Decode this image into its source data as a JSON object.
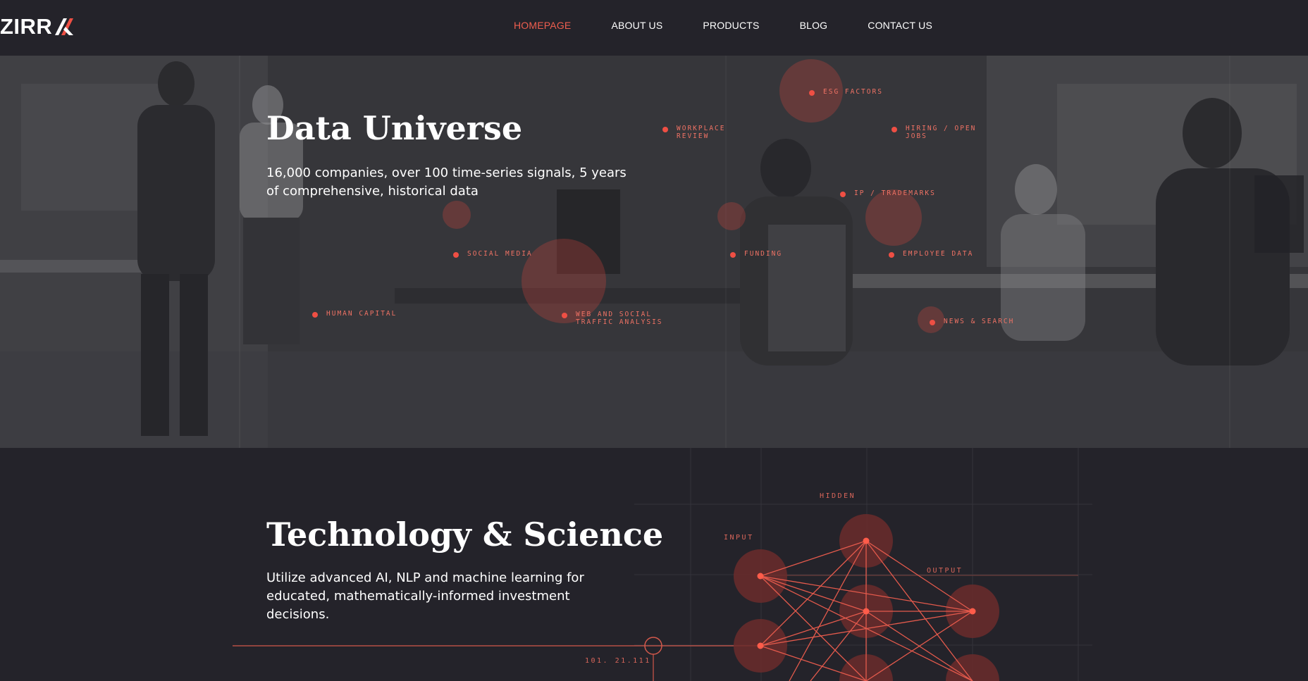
{
  "brand": {
    "name": "ZIRR"
  },
  "nav": {
    "items": [
      {
        "label": "HOMEPAGE",
        "active": true
      },
      {
        "label": "ABOUT US",
        "active": false
      },
      {
        "label": "PRODUCTS",
        "active": false
      },
      {
        "label": "BLOG",
        "active": false
      },
      {
        "label": "CONTACT US",
        "active": false
      }
    ]
  },
  "hero": {
    "title": "Data Universe",
    "subtitle": "16,000 companies, over 100 time-series signals, 5 years of comprehensive, historical data",
    "tags": [
      {
        "line1": "ESG FACTORS",
        "line2": ""
      },
      {
        "line1": "WORKPLACE",
        "line2": "REVIEW"
      },
      {
        "line1": "HIRING / OPEN",
        "line2": "JOBS"
      },
      {
        "line1": "IP / TRADEMARKS",
        "line2": ""
      },
      {
        "line1": "SOCIAL MEDIA",
        "line2": ""
      },
      {
        "line1": "FUNDING",
        "line2": ""
      },
      {
        "line1": "EMPLOYEE DATA",
        "line2": ""
      },
      {
        "line1": "HUMAN CAPITAL",
        "line2": ""
      },
      {
        "line1": "WEB AND SOCIAL",
        "line2": "TRAFFIC ANALYSIS"
      },
      {
        "line1": "NEWS & SEARCH",
        "line2": ""
      }
    ]
  },
  "tech": {
    "title": "Technology & Science",
    "subtitle": "Utilize advanced AI, NLP and machine learning for educated, mathematically-informed investment decisions.",
    "diagram": {
      "label_input": "INPUT",
      "label_hidden": "HIDDEN",
      "label_output": "OUTPUT",
      "code": "101. 21.111"
    }
  },
  "colors": {
    "accent": "#ee5e4f",
    "background": "#24232a"
  }
}
